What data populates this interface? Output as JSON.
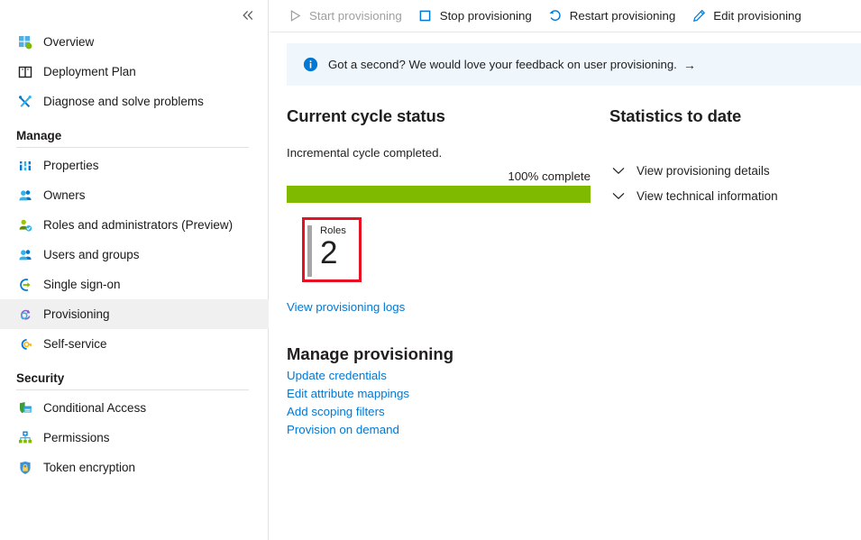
{
  "sidebar": {
    "collapse_icon": "double-chevron-left-icon",
    "top_items": [
      {
        "label": "Overview",
        "icon": "overview-grid-icon",
        "selected": false
      },
      {
        "label": "Deployment Plan",
        "icon": "book-icon",
        "selected": false
      },
      {
        "label": "Diagnose and solve problems",
        "icon": "tools-icon",
        "selected": false
      }
    ],
    "groups": [
      {
        "title": "Manage",
        "items": [
          {
            "label": "Properties",
            "icon": "properties-bars-icon",
            "selected": false
          },
          {
            "label": "Owners",
            "icon": "owners-people-icon",
            "selected": false
          },
          {
            "label": "Roles and administrators (Preview)",
            "icon": "roles-person-icon",
            "selected": false
          },
          {
            "label": "Users and groups",
            "icon": "users-group-icon",
            "selected": false
          },
          {
            "label": "Single sign-on",
            "icon": "single-sign-on-icon",
            "selected": false
          },
          {
            "label": "Provisioning",
            "icon": "provisioning-icon",
            "selected": true
          },
          {
            "label": "Self-service",
            "icon": "self-service-key-icon",
            "selected": false
          }
        ]
      },
      {
        "title": "Security",
        "items": [
          {
            "label": "Conditional Access",
            "icon": "conditional-access-shield-icon",
            "selected": false
          },
          {
            "label": "Permissions",
            "icon": "permissions-tree-icon",
            "selected": false
          },
          {
            "label": "Token encryption",
            "icon": "token-encryption-lock-icon",
            "selected": false
          }
        ]
      }
    ]
  },
  "toolbar": {
    "commands": [
      {
        "label": "Start provisioning",
        "icon": "play-triangle-icon",
        "disabled": true
      },
      {
        "label": "Stop provisioning",
        "icon": "stop-square-icon",
        "disabled": false
      },
      {
        "label": "Restart provisioning",
        "icon": "restart-arrow-icon",
        "disabled": false
      },
      {
        "label": "Edit provisioning",
        "icon": "pencil-edit-icon",
        "disabled": false
      }
    ]
  },
  "banner": {
    "icon": "info-circle-icon",
    "text": "Got a second? We would love your feedback on user provisioning.",
    "arrow": "→"
  },
  "cycle_status": {
    "title": "Current cycle status",
    "status_text": "Incremental cycle completed.",
    "percent_label": "100% complete",
    "percent_value": 100,
    "tile": {
      "label": "Roles",
      "value": "2"
    },
    "logs_link": "View provisioning logs"
  },
  "manage_provisioning": {
    "title": "Manage provisioning",
    "links": [
      "Update credentials",
      "Edit attribute mappings",
      "Add scoping filters",
      "Provision on demand"
    ]
  },
  "statistics": {
    "title": "Statistics to date",
    "expanders": [
      {
        "label": "View provisioning details",
        "icon": "chevron-down-icon"
      },
      {
        "label": "View technical information",
        "icon": "chevron-down-icon"
      }
    ]
  },
  "colors": {
    "accent_link": "#0078d4",
    "progress_green": "#7fba00",
    "annotation_red": "#e81123",
    "banner_bg": "#eff6fc",
    "selection_bg": "#f0f0f0"
  }
}
